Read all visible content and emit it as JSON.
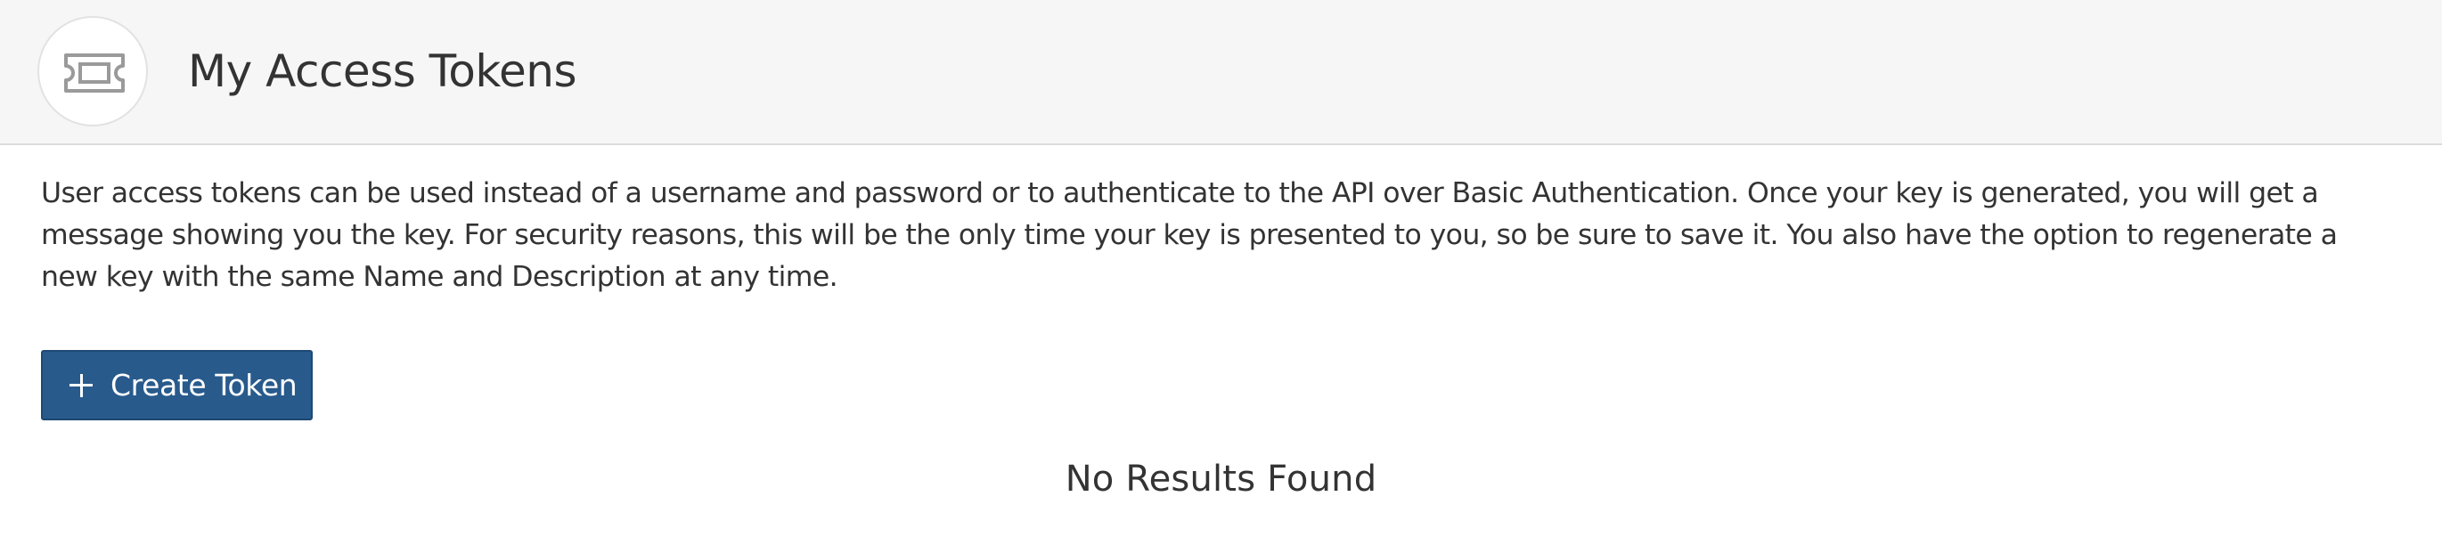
{
  "header": {
    "icon": "ticket-icon",
    "title": "My Access Tokens"
  },
  "main": {
    "description": "User access tokens can be used instead of a username and password or to authenticate to the API over Basic Authentication. Once your key is generated, you will get a message showing you the key. For security reasons, this will be the only time your key is presented to you, so be sure to save it. You also have the option to regenerate a new key with the same Name and Description at any time.",
    "create_button": {
      "icon": "plus-icon",
      "label": "Create Token"
    },
    "empty_state": "No Results Found"
  },
  "colors": {
    "header_background": "#f6f6f6",
    "button_background": "#285a8c",
    "text": "#333333"
  }
}
